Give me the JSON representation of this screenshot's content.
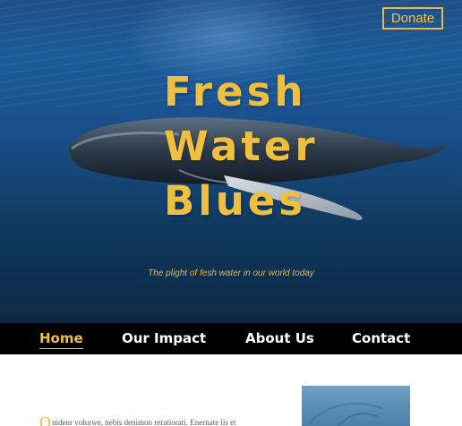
{
  "header": {
    "donate_label": "Donate"
  },
  "hero": {
    "title_lines": [
      "Fresh",
      "Water",
      "Blues"
    ],
    "tagline": "The plight of fesh water in our world today",
    "image": "humpback-whale-underwater"
  },
  "nav": {
    "items": [
      {
        "label": "Home",
        "active": true
      },
      {
        "label": "Our Impact",
        "active": false
      },
      {
        "label": "About Us",
        "active": false
      },
      {
        "label": "Contact",
        "active": false
      }
    ]
  },
  "content": {
    "intro_dropcap": "O",
    "intro_text": "nidenr volurwe, nebis denimon reratiorati. Enernate lis et",
    "thumbnail": "underwater-photo"
  },
  "colors": {
    "accent": "#f0bf3d",
    "nav_background": "#000000",
    "water": "#1a5290"
  }
}
